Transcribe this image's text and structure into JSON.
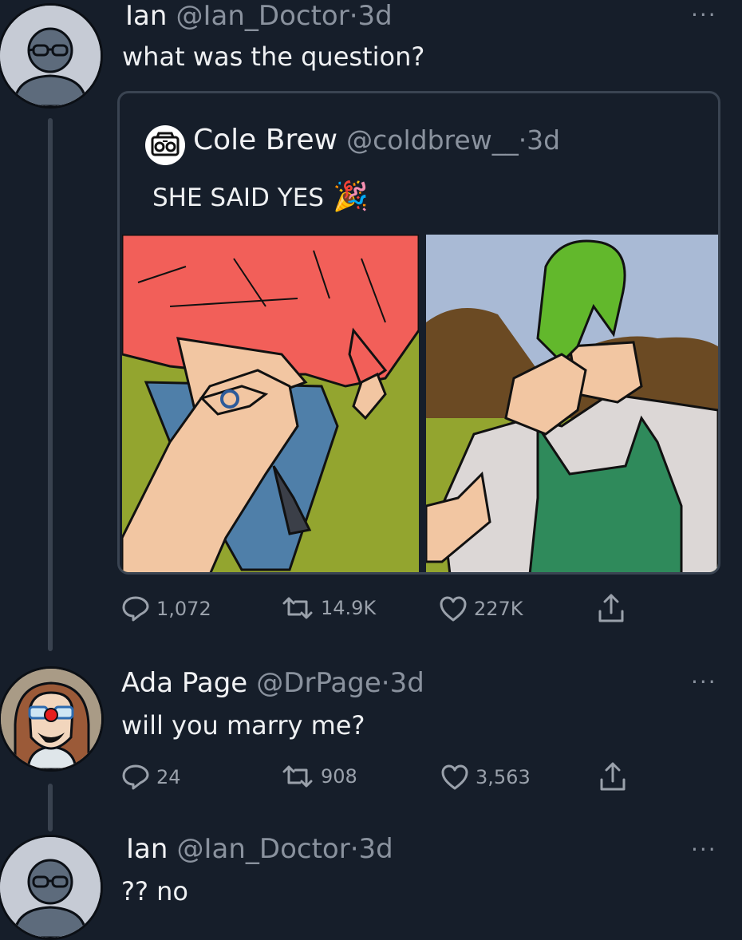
{
  "tweets": [
    {
      "name": "Ian",
      "handle": "@Ian_Doctor",
      "time": "·3d",
      "text": "what was the question?",
      "more": "···",
      "quote": {
        "name": "Cole Brew",
        "handle": "@coldbrew__",
        "time": "·3d",
        "text": "SHE SAID YES",
        "emoji": "🎉"
      },
      "actions": {
        "replies": "1,072",
        "retweets": "14.9K",
        "likes": "227K"
      }
    },
    {
      "name": "Ada Page",
      "handle": "@DrPage",
      "time": "·3d",
      "text": "will you marry me?",
      "more": "···",
      "actions": {
        "replies": "24",
        "retweets": "908",
        "likes": "3,563"
      }
    },
    {
      "name": "Ian",
      "handle": "@Ian_Doctor",
      "time": "·3d",
      "text": "?? no",
      "more": "···"
    }
  ],
  "colors": {
    "background": "#161e2a",
    "sweater": "#f25f59",
    "grass": "#93a52f",
    "sky": "#a9bad5",
    "hair": "#62b82c",
    "apron": "#2f8a5b"
  },
  "icons": [
    "reply-icon",
    "retweet-icon",
    "like-icon",
    "share-icon",
    "more-icon",
    "boombox-icon"
  ]
}
